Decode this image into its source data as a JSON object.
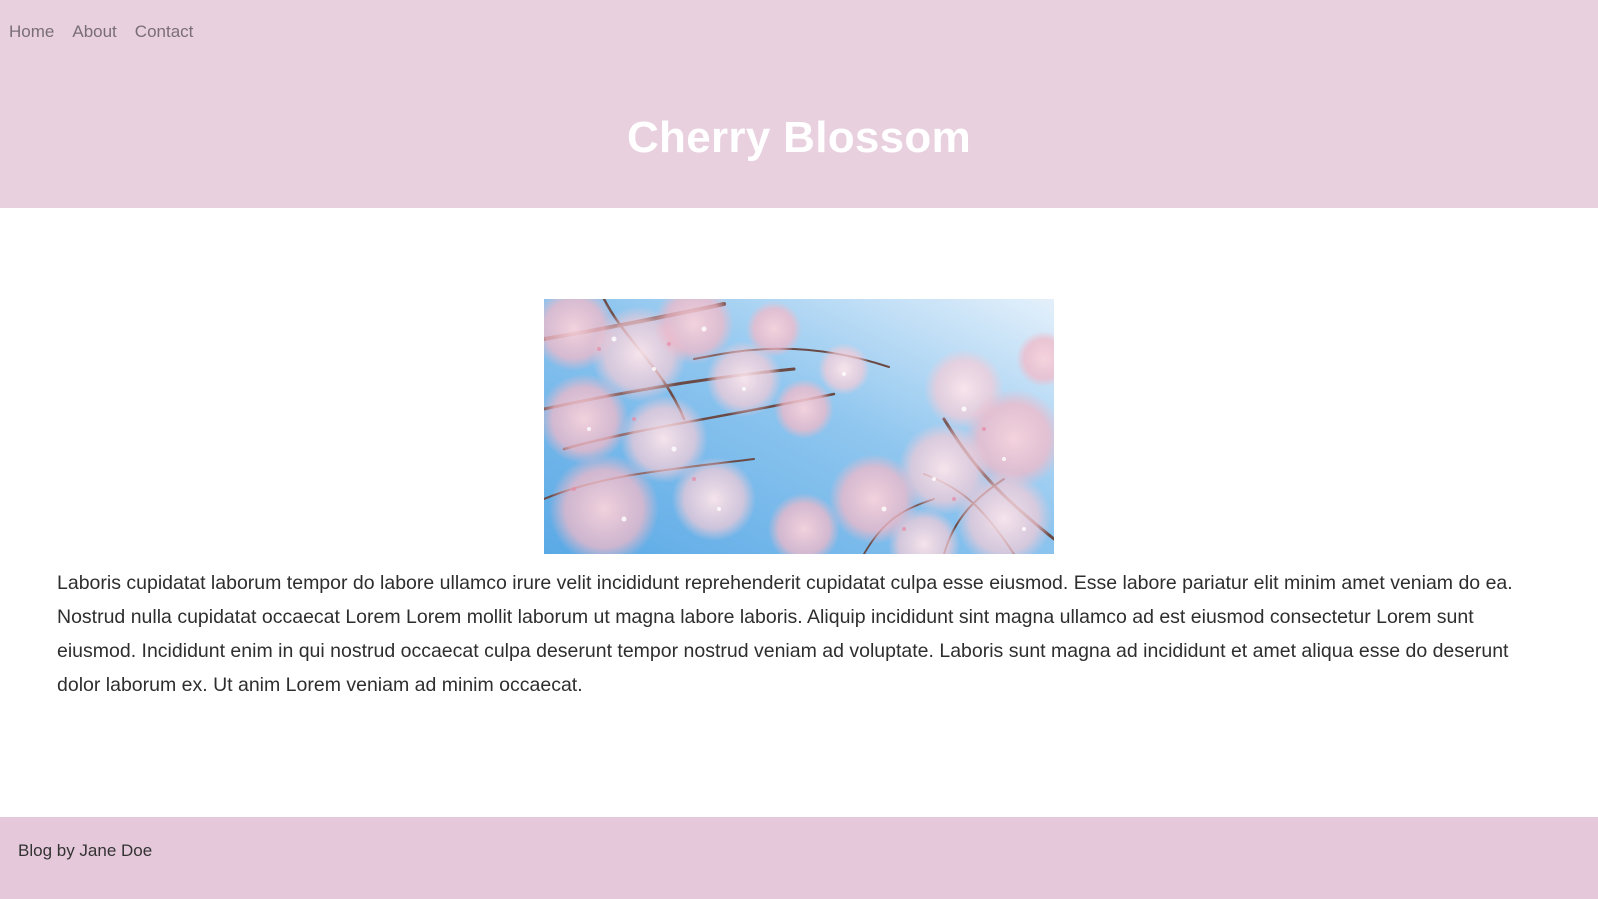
{
  "nav": {
    "items": [
      {
        "label": "Home"
      },
      {
        "label": "About"
      },
      {
        "label": "Contact"
      }
    ]
  },
  "header": {
    "title": "Cherry Blossom"
  },
  "main": {
    "image": {
      "icon": "cherry-blossom-photo"
    },
    "paragraph": "Laboris cupidatat laborum tempor do labore ullamco irure velit incididunt reprehenderit cupidatat culpa esse eiusmod. Esse labore pariatur elit minim amet veniam do ea. Nostrud nulla cupidatat occaecat Lorem Lorem mollit laborum ut magna labore laboris. Aliquip incididunt sint magna ullamco ad est eiusmod consectetur Lorem sunt eiusmod. Incididunt enim in qui nostrud occaecat culpa deserunt tempor nostrud veniam ad voluptate. Laboris sunt magna ad incididunt et amet aliqua esse do deserunt dolor laborum ex. Ut anim Lorem veniam ad minim occaecat."
  },
  "footer": {
    "text": "Blog by Jane Doe"
  },
  "colors": {
    "header_bg": "#e8d0df",
    "footer_bg": "#e5c9db",
    "title_text": "#ffffff",
    "body_text": "#2e2e2e",
    "sky_blue": "#7fbfec",
    "blossom_pink": "#f4c2cf"
  }
}
